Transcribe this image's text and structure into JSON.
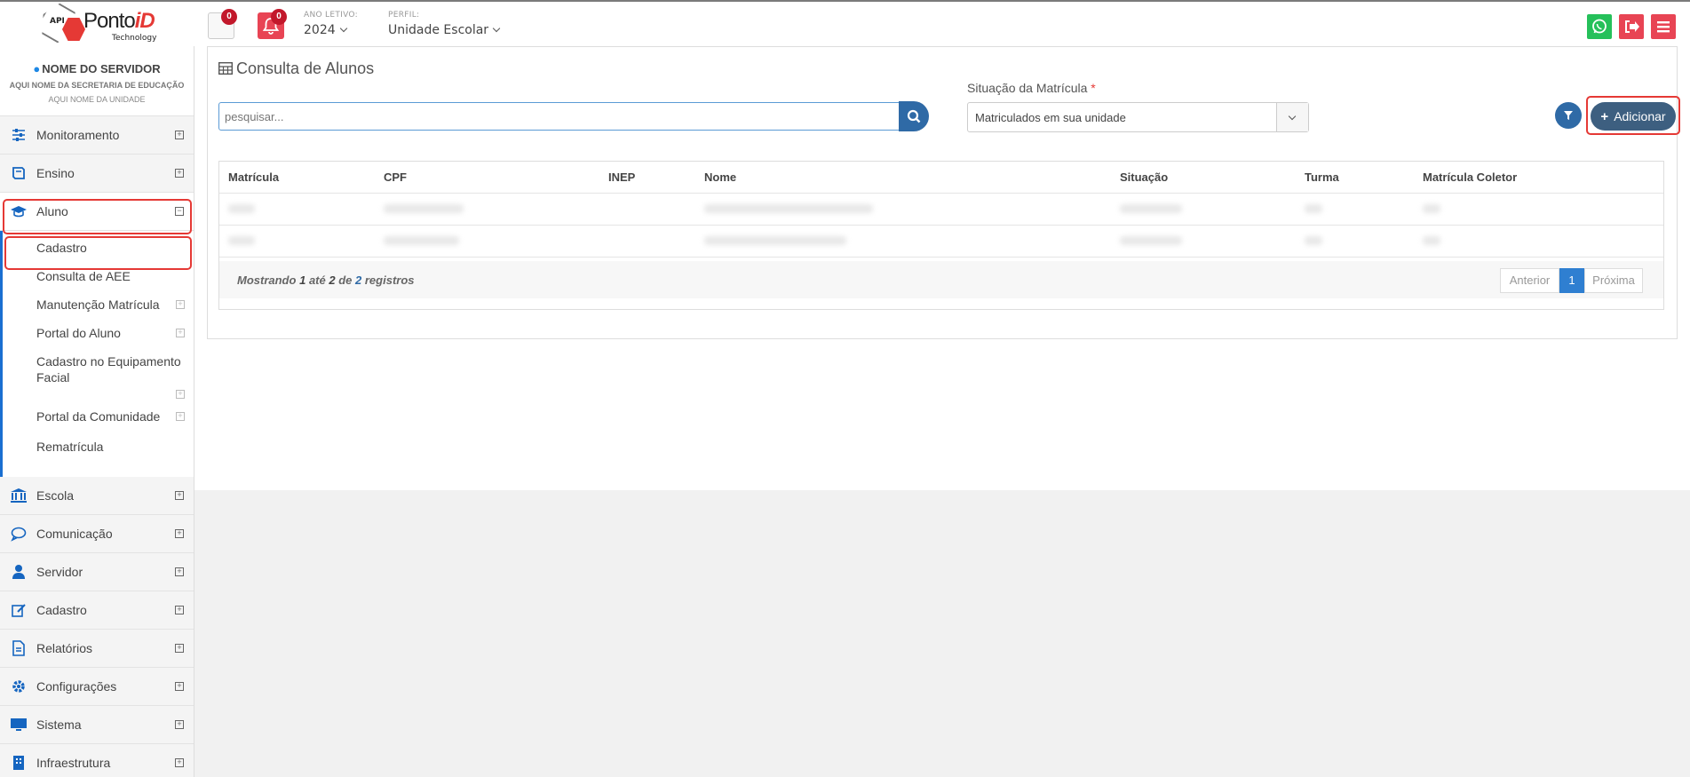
{
  "header": {
    "logo": {
      "small_text": "API",
      "brand_main": "Ponto",
      "brand_accent": "iD",
      "brand_sub": "Technology"
    },
    "messages_badge": "0",
    "notifications_badge": "0",
    "year_label": "ANO LETIVO:",
    "year_value": "2024",
    "profile_label": "PERFIL:",
    "profile_value": "Unidade Escolar",
    "right_buttons": [
      {
        "name": "whatsapp",
        "color": "#25c05a"
      },
      {
        "name": "logout",
        "color": "#e84454"
      },
      {
        "name": "menu",
        "color": "#e84454"
      }
    ]
  },
  "sidebar": {
    "user_name": "NOME DO SERVIDOR",
    "secretaria": "AQUI NOME DA SECRETARIA DE EDUCAÇÃO",
    "unidade": "AQUI NOME DA UNIDADE",
    "items_top": [
      {
        "label": "Monitoramento",
        "icon": "sliders-icon"
      },
      {
        "label": "Ensino",
        "icon": "book-icon"
      },
      {
        "label": "Aluno",
        "icon": "graduation-cap-icon",
        "expanded": true
      }
    ],
    "aluno_sub": [
      {
        "label": "Cadastro",
        "has_plus": false
      },
      {
        "label": "Consulta de AEE",
        "has_plus": false
      },
      {
        "label": "Manutenção Matrícula",
        "has_plus": true
      },
      {
        "label": "Portal do Aluno",
        "has_plus": true
      },
      {
        "label": "Cadastro no Equipamento Facial",
        "has_plus": true
      },
      {
        "label": "Portal da Comunidade",
        "has_plus": true
      },
      {
        "label": "Rematrícula",
        "has_plus": false
      }
    ],
    "items_bottom": [
      {
        "label": "Escola",
        "icon": "bank-icon"
      },
      {
        "label": "Comunicação",
        "icon": "chat-bubble-icon"
      },
      {
        "label": "Servidor",
        "icon": "user-icon"
      },
      {
        "label": "Cadastro",
        "icon": "edit-icon"
      },
      {
        "label": "Relatórios",
        "icon": "file-icon"
      },
      {
        "label": "Configurações",
        "icon": "gear-icon"
      },
      {
        "label": "Sistema",
        "icon": "monitor-icon"
      },
      {
        "label": "Infraestrutura",
        "icon": "building-icon"
      }
    ]
  },
  "main": {
    "title": "Consulta de Alunos",
    "search_placeholder": "pesquisar...",
    "situacao_label": "Situação da Matrícula",
    "situacao_required": "*",
    "situacao_value": "Matriculados em sua unidade",
    "add_label": "Adicionar",
    "table": {
      "columns": [
        "Matrícula",
        "CPF",
        "INEP",
        "Nome",
        "Situação",
        "Turma",
        "Matrícula Coletor"
      ],
      "blurred_rows": 2
    },
    "footer": {
      "prefix": "Mostrando",
      "from": "1",
      "mid": "até",
      "to": "2",
      "of": "de",
      "total": "2",
      "suffix": "registros"
    },
    "pagination": {
      "prev": "Anterior",
      "current": "1",
      "next": "Próxima"
    }
  }
}
